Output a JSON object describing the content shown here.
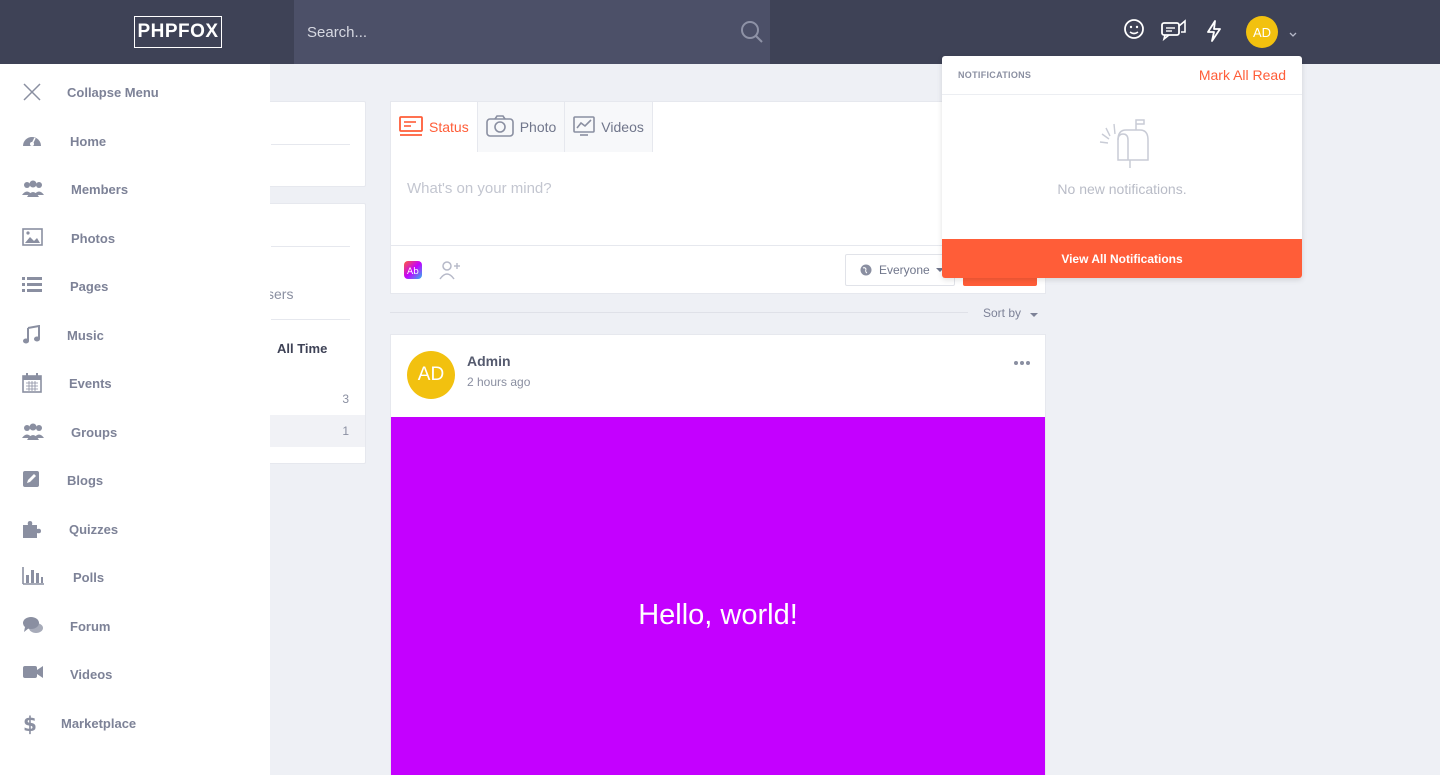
{
  "header": {
    "logo": "PHPFOX",
    "search_placeholder": "Search...",
    "avatar_initials": "AD"
  },
  "sidebar": {
    "collapse_label": "Collapse Menu",
    "items": [
      {
        "label": "Home",
        "icon": "dashboard-icon"
      },
      {
        "label": "Members",
        "icon": "users-icon"
      },
      {
        "label": "Photos",
        "icon": "image-icon"
      },
      {
        "label": "Pages",
        "icon": "list-icon"
      },
      {
        "label": "Music",
        "icon": "music-icon"
      },
      {
        "label": "Events",
        "icon": "calendar-icon"
      },
      {
        "label": "Groups",
        "icon": "groups-icon"
      },
      {
        "label": "Blogs",
        "icon": "edit-icon"
      },
      {
        "label": "Quizzes",
        "icon": "puzzle-icon"
      },
      {
        "label": "Polls",
        "icon": "bar-chart-icon"
      },
      {
        "label": "Forum",
        "icon": "comments-icon"
      },
      {
        "label": "Videos",
        "icon": "video-icon"
      },
      {
        "label": "Marketplace",
        "icon": "dollar-icon"
      }
    ]
  },
  "left_panel": {
    "partial_text": "sers",
    "period_label": "All Time",
    "counts": [
      "3",
      "1"
    ]
  },
  "composer": {
    "tabs": [
      {
        "label": "Status",
        "icon": "status-icon",
        "active": true
      },
      {
        "label": "Photo",
        "icon": "camera-icon",
        "active": false
      },
      {
        "label": "Videos",
        "icon": "chart-line-icon",
        "active": false
      }
    ],
    "placeholder": "What's on your mind?",
    "privacy": "Everyone"
  },
  "feed": {
    "sort_label": "Sort by"
  },
  "post": {
    "author": "Admin",
    "initials": "AD",
    "time": "2 hours ago",
    "text": "Hello, world!",
    "background": "#c400ff"
  },
  "notifications": {
    "title": "NOTIFICATIONS",
    "mark_all": "Mark All Read",
    "empty": "No new notifications.",
    "view_all": "View All Notifications"
  },
  "colors": {
    "accent": "#ff5d38",
    "topbar": "#3e4256",
    "avatar": "#f2c10f"
  }
}
